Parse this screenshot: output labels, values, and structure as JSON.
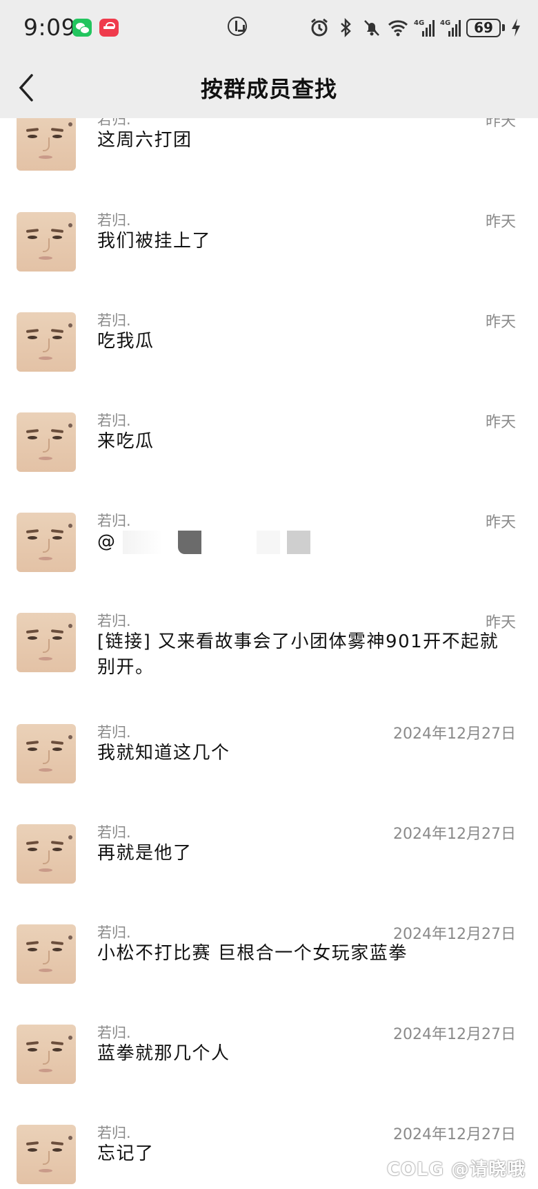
{
  "status_bar": {
    "time": "9:09",
    "battery": "69",
    "icons": [
      "wechat-icon",
      "app-icon",
      "data-saver-icon",
      "alarm-icon",
      "bluetooth-icon",
      "mute-icon",
      "wifi-icon",
      "signal-4g-icon",
      "signal-4g-icon",
      "battery-icon",
      "charging-icon"
    ]
  },
  "nav": {
    "title": "按群成员查找"
  },
  "messages": [
    {
      "sender": "若归.",
      "date": "昨天",
      "text": "这周六打团"
    },
    {
      "sender": "若归.",
      "date": "昨天",
      "text": "我们被挂上了"
    },
    {
      "sender": "若归.",
      "date": "昨天",
      "text": "吃我瓜"
    },
    {
      "sender": "若归.",
      "date": "昨天",
      "text": "来吃瓜"
    },
    {
      "sender": "若归.",
      "date": "昨天",
      "text": "@"
    },
    {
      "sender": "若归.",
      "date": "昨天",
      "text": "[链接] 又来看故事会了小团体雾神901开不起就别开。"
    },
    {
      "sender": "若归.",
      "date": "2024年12月27日",
      "text": "我就知道这几个"
    },
    {
      "sender": "若归.",
      "date": "2024年12月27日",
      "text": "再就是他了"
    },
    {
      "sender": "若归.",
      "date": "2024年12月27日",
      "text": "小松不打比赛 巨根合一个女玩家蓝拳"
    },
    {
      "sender": "若归.",
      "date": "2024年12月27日",
      "text": "蓝拳就那几个人"
    },
    {
      "sender": "若归.",
      "date": "2024年12月27日",
      "text": "忘记了"
    }
  ],
  "watermark": "COLG @请晓哦",
  "colors": {
    "bar_background": "#ededed",
    "page_background": "#ffffff",
    "meta_text": "#8a8a8a"
  }
}
